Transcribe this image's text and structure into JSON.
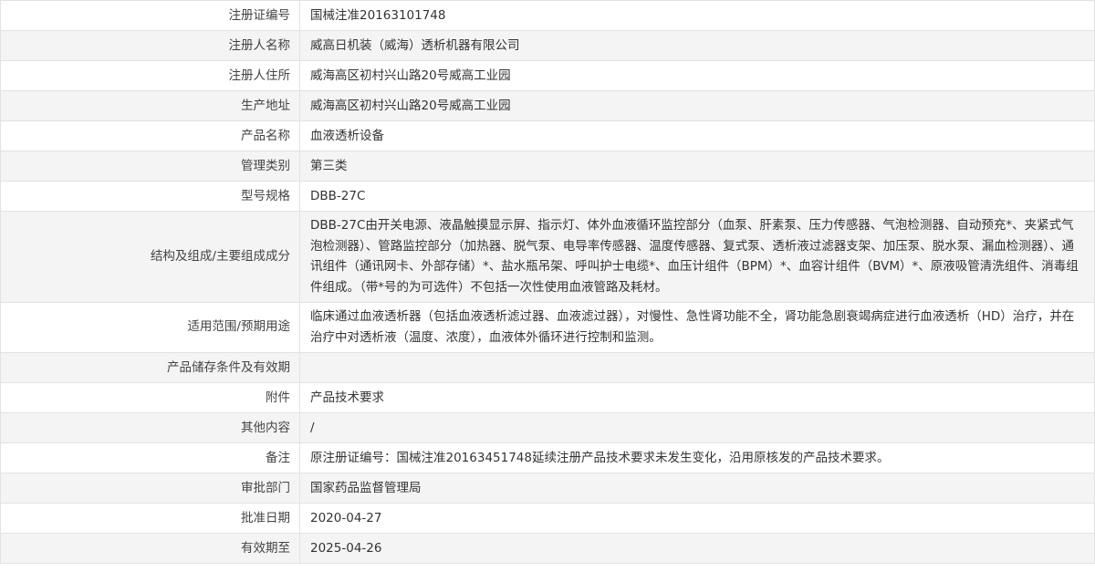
{
  "rows": [
    {
      "label": "注册证编号",
      "value": "国械注准20163101748"
    },
    {
      "label": "注册人名称",
      "value": "威高日机装（威海）透析机器有限公司"
    },
    {
      "label": "注册人住所",
      "value": "威海高区初村兴山路20号威高工业园"
    },
    {
      "label": "生产地址",
      "value": "威海高区初村兴山路20号威高工业园"
    },
    {
      "label": "产品名称",
      "value": "血液透析设备"
    },
    {
      "label": "管理类别",
      "value": "第三类"
    },
    {
      "label": "型号规格",
      "value": "DBB-27C"
    },
    {
      "label": "结构及组成/主要组成成分",
      "value": "DBB-27C由开关电源、液晶触摸显示屏、指示灯、体外血液循环监控部分（血泵、肝素泵、压力传感器、气泡检测器、自动预充*、夹紧式气泡检测器）、管路监控部分（加热器、脱气泵、电导率传感器、温度传感器、复式泵、透析液过滤器支架、加压泵、脱水泵、漏血检测器）、通讯组件（通讯网卡、外部存储）*、盐水瓶吊架、呼叫护士电缆*、血压计组件（BPM）*、血容计组件（BVM）*、原液吸管清洗组件、消毒组件组成。（带*号的为可选件）不包括一次性使用血液管路及耗材。"
    },
    {
      "label": "适用范围/预期用途",
      "value": "临床通过血液透析器（包括血液透析滤过器、血液滤过器），对慢性、急性肾功能不全，肾功能急剧衰竭病症进行血液透析（HD）治疗，并在治疗中对透析液（温度、浓度），血液体外循环进行控制和监测。"
    },
    {
      "label": "产品储存条件及有效期",
      "value": ""
    },
    {
      "label": "附件",
      "value": "产品技术要求"
    },
    {
      "label": "其他内容",
      "value": "/"
    },
    {
      "label": "备注",
      "value": "原注册证编号：国械注准20163451748延续注册产品技术要求未发生变化，沿用原核发的产品技术要求。"
    },
    {
      "label": "审批部门",
      "value": "国家药品监督管理局"
    },
    {
      "label": "批准日期",
      "value": "2020-04-27"
    },
    {
      "label": "有效期至",
      "value": "2025-04-26"
    }
  ]
}
